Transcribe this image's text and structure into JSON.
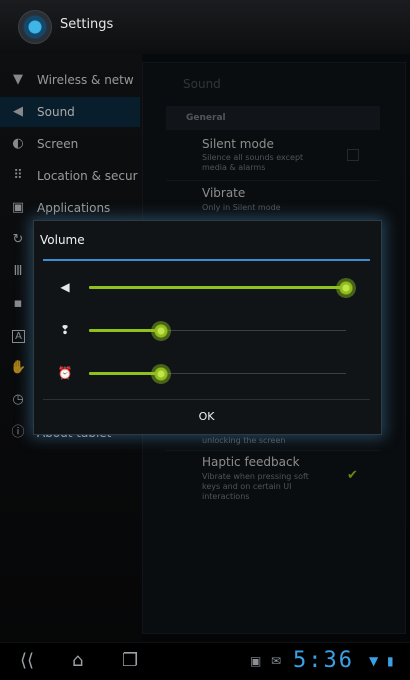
{
  "app": {
    "title": "Settings"
  },
  "nav": {
    "items": [
      {
        "label": "Wireless & netw",
        "icon": "wifi-icon"
      },
      {
        "label": "Sound",
        "icon": "speaker-icon",
        "selected": true
      },
      {
        "label": "Screen",
        "icon": "brightness-icon"
      },
      {
        "label": "Location & secur",
        "icon": "grid-lock-icon"
      },
      {
        "label": "Applications",
        "icon": "applications-icon"
      },
      {
        "label": "",
        "icon": "sync-icon"
      },
      {
        "label": "",
        "icon": "storage-icon"
      },
      {
        "label": "",
        "icon": "sd-card-icon"
      },
      {
        "label": "",
        "icon": "language-icon"
      },
      {
        "label": "",
        "icon": "hand-icon"
      },
      {
        "label": "",
        "icon": "clock-icon"
      },
      {
        "label": "About tablet",
        "icon": "info-icon"
      }
    ]
  },
  "main": {
    "section_title": "Sound",
    "category": "General",
    "prefs": [
      {
        "title": "Silent mode",
        "summary": "Silence all sounds except media & alarms"
      },
      {
        "title": "Vibrate",
        "summary": "Only in Silent mode"
      },
      {
        "title": "",
        "summary": "unlocking the screen"
      },
      {
        "title": "Haptic feedback",
        "summary": "Vibrate when pressing soft keys and on certain UI interactions"
      }
    ]
  },
  "dialog": {
    "title": "Volume",
    "sliders": [
      {
        "name": "media",
        "icon": "speaker-icon",
        "level": 1.0
      },
      {
        "name": "notification",
        "icon": "notification-icon",
        "level": 0.28
      },
      {
        "name": "alarm",
        "icon": "alarm-icon",
        "level": 0.28
      }
    ],
    "ok_label": "OK"
  },
  "system_bar": {
    "time": "5:36",
    "back": "back-icon",
    "home": "home-icon",
    "recent": "recent-apps-icon"
  },
  "colors": {
    "accent": "#3a8fd0",
    "slider": "#8fc01c",
    "clock": "#3aa1e6"
  }
}
